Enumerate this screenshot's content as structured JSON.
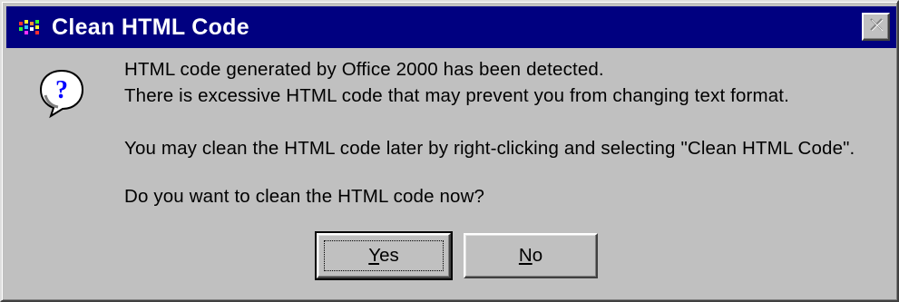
{
  "window": {
    "title": "Clean HTML Code",
    "close_glyph": "×"
  },
  "icons": {
    "app": "app-logo-icon",
    "message": "question-icon",
    "close": "close-icon"
  },
  "message": {
    "line1": "HTML code generated by Office 2000 has been detected.",
    "line2": "There is excessive HTML code that may prevent you from changing text format.",
    "line3": "You may clean the HTML code later by right-clicking and selecting \"Clean HTML Code\".",
    "line4": "Do you want to clean the HTML code now?"
  },
  "buttons": {
    "yes": {
      "mnemonic": "Y",
      "rest": "es"
    },
    "no": {
      "mnemonic": "N",
      "rest": "o"
    }
  },
  "colors": {
    "titlebar": "#000080",
    "face": "#c0c0c0",
    "title_text": "#ffffff"
  }
}
